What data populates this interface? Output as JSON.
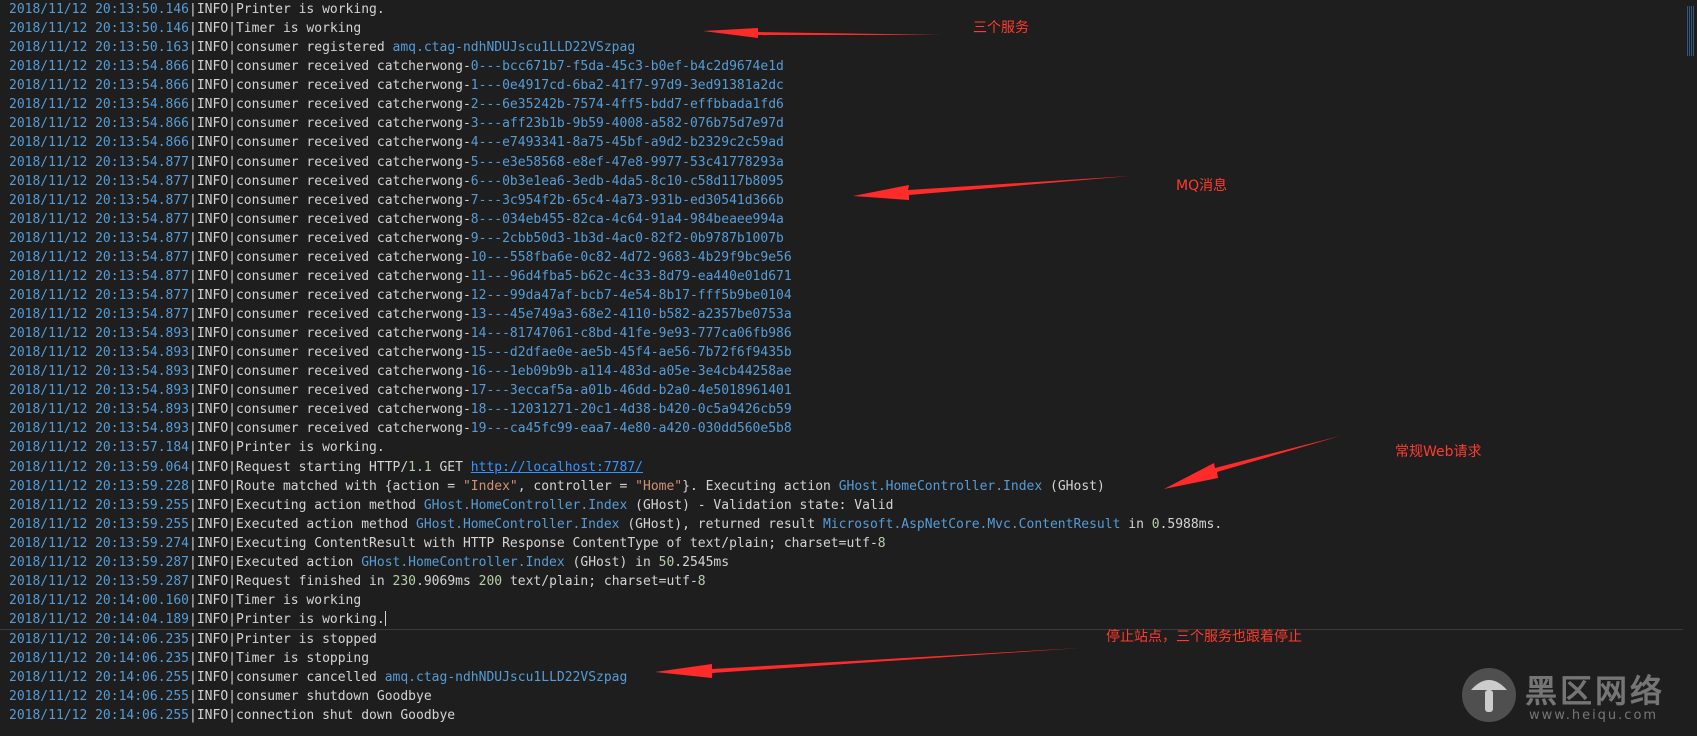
{
  "log": [
    {
      "ts": "2018/11/12 20:13:50.146",
      "level": "INFO",
      "segments": [
        {
          "t": "Printer is working.",
          "c": "text"
        }
      ]
    },
    {
      "ts": "2018/11/12 20:13:50.146",
      "level": "INFO",
      "segments": [
        {
          "t": "Timer is working",
          "c": "text"
        }
      ]
    },
    {
      "ts": "2018/11/12 20:13:50.163",
      "level": "INFO",
      "segments": [
        {
          "t": "consumer registered ",
          "c": "text"
        },
        {
          "t": "amq.ctag-ndhNDUJscu1LLD22VSzpag",
          "c": "blue"
        }
      ]
    },
    {
      "ts": "2018/11/12 20:13:54.866",
      "level": "INFO",
      "segments": [
        {
          "t": "consumer received catcherwong-",
          "c": "text"
        },
        {
          "t": "0---bcc671b7-f5da-45c3-b0ef-b4c2d9674e1d",
          "c": "blue"
        }
      ]
    },
    {
      "ts": "2018/11/12 20:13:54.866",
      "level": "INFO",
      "segments": [
        {
          "t": "consumer received catcherwong-",
          "c": "text"
        },
        {
          "t": "1---0e4917cd-6ba2-41f7-97d9-3ed91381a2dc",
          "c": "blue"
        }
      ]
    },
    {
      "ts": "2018/11/12 20:13:54.866",
      "level": "INFO",
      "segments": [
        {
          "t": "consumer received catcherwong-",
          "c": "text"
        },
        {
          "t": "2---6e35242b-7574-4ff5-bdd7-effbbada1fd6",
          "c": "blue"
        }
      ]
    },
    {
      "ts": "2018/11/12 20:13:54.866",
      "level": "INFO",
      "segments": [
        {
          "t": "consumer received catcherwong-",
          "c": "text"
        },
        {
          "t": "3---aff23b1b-9b59-4008-a582-076b75d7e97d",
          "c": "blue"
        }
      ]
    },
    {
      "ts": "2018/11/12 20:13:54.866",
      "level": "INFO",
      "segments": [
        {
          "t": "consumer received catcherwong-",
          "c": "text"
        },
        {
          "t": "4---e7493341-8a75-45bf-a9d2-b2329c2c59ad",
          "c": "blue"
        }
      ]
    },
    {
      "ts": "2018/11/12 20:13:54.877",
      "level": "INFO",
      "segments": [
        {
          "t": "consumer received catcherwong-",
          "c": "text"
        },
        {
          "t": "5---e3e58568-e8ef-47e8-9977-53c41778293a",
          "c": "blue"
        }
      ]
    },
    {
      "ts": "2018/11/12 20:13:54.877",
      "level": "INFO",
      "segments": [
        {
          "t": "consumer received catcherwong-",
          "c": "text"
        },
        {
          "t": "6---0b3e1ea6-3edb-4da5-8c10-c58d117b8095",
          "c": "blue"
        }
      ]
    },
    {
      "ts": "2018/11/12 20:13:54.877",
      "level": "INFO",
      "segments": [
        {
          "t": "consumer received catcherwong-",
          "c": "text"
        },
        {
          "t": "7---3c954f2b-65c4-4a73-931b-ed30541d366b",
          "c": "blue"
        }
      ]
    },
    {
      "ts": "2018/11/12 20:13:54.877",
      "level": "INFO",
      "segments": [
        {
          "t": "consumer received catcherwong-",
          "c": "text"
        },
        {
          "t": "8---034eb455-82ca-4c64-91a4-984beaee994a",
          "c": "blue"
        }
      ]
    },
    {
      "ts": "2018/11/12 20:13:54.877",
      "level": "INFO",
      "segments": [
        {
          "t": "consumer received catcherwong-",
          "c": "text"
        },
        {
          "t": "9---2cbb50d3-1b3d-4ac0-82f2-0b9787b1007b",
          "c": "blue"
        }
      ]
    },
    {
      "ts": "2018/11/12 20:13:54.877",
      "level": "INFO",
      "segments": [
        {
          "t": "consumer received catcherwong-",
          "c": "text"
        },
        {
          "t": "10---558fba6e-0c82-4d72-9683-4b29f9bc9e56",
          "c": "blue"
        }
      ]
    },
    {
      "ts": "2018/11/12 20:13:54.877",
      "level": "INFO",
      "segments": [
        {
          "t": "consumer received catcherwong-",
          "c": "text"
        },
        {
          "t": "11---96d4fba5-b62c-4c33-8d79-ea440e01d671",
          "c": "blue"
        }
      ]
    },
    {
      "ts": "2018/11/12 20:13:54.877",
      "level": "INFO",
      "segments": [
        {
          "t": "consumer received catcherwong-",
          "c": "text"
        },
        {
          "t": "12---99da47af-bcb7-4e54-8b17-fff5b9be0104",
          "c": "blue"
        }
      ]
    },
    {
      "ts": "2018/11/12 20:13:54.877",
      "level": "INFO",
      "segments": [
        {
          "t": "consumer received catcherwong-",
          "c": "text"
        },
        {
          "t": "13---45e749a3-68e2-4110-b582-a2357be0753a",
          "c": "blue"
        }
      ]
    },
    {
      "ts": "2018/11/12 20:13:54.893",
      "level": "INFO",
      "segments": [
        {
          "t": "consumer received catcherwong-",
          "c": "text"
        },
        {
          "t": "14---81747061-c8bd-41fe-9e93-777ca06fb986",
          "c": "blue"
        }
      ]
    },
    {
      "ts": "2018/11/12 20:13:54.893",
      "level": "INFO",
      "segments": [
        {
          "t": "consumer received catcherwong-",
          "c": "text"
        },
        {
          "t": "15---d2dfae0e-ae5b-45f4-ae56-7b72f6f9435b",
          "c": "blue"
        }
      ]
    },
    {
      "ts": "2018/11/12 20:13:54.893",
      "level": "INFO",
      "segments": [
        {
          "t": "consumer received catcherwong-",
          "c": "text"
        },
        {
          "t": "16---1eb09b9b-a114-483d-a05e-3e4cb44258ae",
          "c": "blue"
        }
      ]
    },
    {
      "ts": "2018/11/12 20:13:54.893",
      "level": "INFO",
      "segments": [
        {
          "t": "consumer received catcherwong-",
          "c": "text"
        },
        {
          "t": "17---3eccaf5a-a01b-46dd-b2a0-4e5018961401",
          "c": "blue"
        }
      ]
    },
    {
      "ts": "2018/11/12 20:13:54.893",
      "level": "INFO",
      "segments": [
        {
          "t": "consumer received catcherwong-",
          "c": "text"
        },
        {
          "t": "18---12031271-20c1-4d38-b420-0c5a9426cb59",
          "c": "blue"
        }
      ]
    },
    {
      "ts": "2018/11/12 20:13:54.893",
      "level": "INFO",
      "segments": [
        {
          "t": "consumer received catcherwong-",
          "c": "text"
        },
        {
          "t": "19---ca45fc99-eaa7-4e80-a420-030dd560e5b8",
          "c": "blue"
        }
      ]
    },
    {
      "ts": "2018/11/12 20:13:57.184",
      "level": "INFO",
      "segments": [
        {
          "t": "Printer is working.",
          "c": "text"
        }
      ]
    },
    {
      "ts": "2018/11/12 20:13:59.064",
      "level": "INFO",
      "segments": [
        {
          "t": "Request starting HTTP/",
          "c": "text"
        },
        {
          "t": "1.1",
          "c": "num"
        },
        {
          "t": " GET ",
          "c": "text"
        },
        {
          "t": "http://localhost:7787/",
          "c": "link"
        }
      ]
    },
    {
      "ts": "2018/11/12 20:13:59.228",
      "level": "INFO",
      "segments": [
        {
          "t": "Route matched with {action = ",
          "c": "text"
        },
        {
          "t": "\"Index\"",
          "c": "str"
        },
        {
          "t": ", controller = ",
          "c": "text"
        },
        {
          "t": "\"Home\"",
          "c": "str"
        },
        {
          "t": "}. Executing action ",
          "c": "text"
        },
        {
          "t": "GHost.HomeController.Index",
          "c": "blue"
        },
        {
          "t": " (GHost)",
          "c": "text"
        }
      ]
    },
    {
      "ts": "2018/11/12 20:13:59.255",
      "level": "INFO",
      "segments": [
        {
          "t": "Executing action method ",
          "c": "text"
        },
        {
          "t": "GHost.HomeController.Index",
          "c": "blue"
        },
        {
          "t": " (GHost) - Validation state: Valid",
          "c": "text"
        }
      ]
    },
    {
      "ts": "2018/11/12 20:13:59.255",
      "level": "INFO",
      "segments": [
        {
          "t": "Executed action method ",
          "c": "text"
        },
        {
          "t": "GHost.HomeController.Index",
          "c": "blue"
        },
        {
          "t": " (GHost), returned result ",
          "c": "text"
        },
        {
          "t": "Microsoft.AspNetCore.Mvc.ContentResult",
          "c": "blue"
        },
        {
          "t": " in ",
          "c": "text"
        },
        {
          "t": "0",
          "c": "num"
        },
        {
          "t": ".5988ms.",
          "c": "text"
        }
      ]
    },
    {
      "ts": "2018/11/12 20:13:59.274",
      "level": "INFO",
      "segments": [
        {
          "t": "Executing ContentResult with HTTP Response ContentType of text/plain; charset=utf-",
          "c": "text"
        },
        {
          "t": "8",
          "c": "num"
        }
      ]
    },
    {
      "ts": "2018/11/12 20:13:59.287",
      "level": "INFO",
      "segments": [
        {
          "t": "Executed action ",
          "c": "text"
        },
        {
          "t": "GHost.HomeController.Index",
          "c": "blue"
        },
        {
          "t": " (GHost) in ",
          "c": "text"
        },
        {
          "t": "50",
          "c": "num"
        },
        {
          "t": ".2545ms",
          "c": "text"
        }
      ]
    },
    {
      "ts": "2018/11/12 20:13:59.287",
      "level": "INFO",
      "segments": [
        {
          "t": "Request finished in ",
          "c": "text"
        },
        {
          "t": "230",
          "c": "num"
        },
        {
          "t": ".9069ms ",
          "c": "text"
        },
        {
          "t": "200",
          "c": "num"
        },
        {
          "t": " text/plain; charset=utf-",
          "c": "text"
        },
        {
          "t": "8",
          "c": "num"
        }
      ]
    },
    {
      "ts": "2018/11/12 20:14:00.160",
      "level": "INFO",
      "segments": [
        {
          "t": "Timer is working",
          "c": "text"
        }
      ]
    },
    {
      "ts": "2018/11/12 20:14:04.189",
      "level": "INFO",
      "segments": [
        {
          "t": "Printer is working.",
          "c": "text"
        }
      ],
      "cursor": true
    },
    {
      "ts": "2018/11/12 20:14:06.235",
      "level": "INFO",
      "segments": [
        {
          "t": "Printer is stopped",
          "c": "text"
        }
      ]
    },
    {
      "ts": "2018/11/12 20:14:06.235",
      "level": "INFO",
      "segments": [
        {
          "t": "Timer is stopping",
          "c": "text"
        }
      ]
    },
    {
      "ts": "2018/11/12 20:14:06.255",
      "level": "INFO",
      "segments": [
        {
          "t": "consumer cancelled ",
          "c": "text"
        },
        {
          "t": "amq.ctag-ndhNDUJscu1LLD22VSzpag",
          "c": "blue"
        }
      ]
    },
    {
      "ts": "2018/11/12 20:14:06.255",
      "level": "INFO",
      "segments": [
        {
          "t": "consumer shutdown Goodbye",
          "c": "text"
        }
      ]
    },
    {
      "ts": "2018/11/12 20:14:06.255",
      "level": "INFO",
      "segments": [
        {
          "t": "connection shut down Goodbye",
          "c": "text"
        }
      ]
    }
  ],
  "annotations": {
    "three_services": "三个服务",
    "mq_messages": "MQ消息",
    "web_request": "常规Web请求",
    "stop_site": "停止站点，三个服务也跟着停止"
  },
  "watermark": {
    "brand": "黑区网络",
    "url": "www.heiqu.com"
  },
  "colors": {
    "background": "#1e1e1e",
    "timestamp": "#569cd6",
    "text": "#d4d4d4",
    "identifier": "#569cd6",
    "string": "#ce9178",
    "number": "#b5cea8",
    "annotation": "#ff3b2f"
  }
}
